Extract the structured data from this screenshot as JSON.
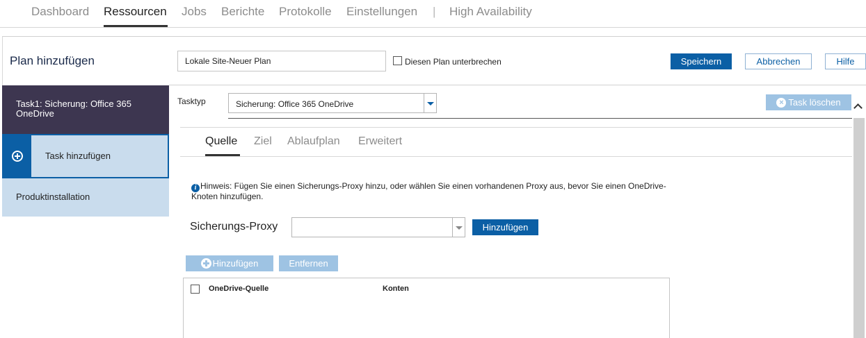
{
  "nav": {
    "items": [
      {
        "label": "Dashboard"
      },
      {
        "label": "Ressourcen"
      },
      {
        "label": "Jobs"
      },
      {
        "label": "Berichte"
      },
      {
        "label": "Protokolle"
      },
      {
        "label": "Einstellungen"
      },
      {
        "label": "High Availability"
      }
    ],
    "separator": "|",
    "active": "Ressourcen"
  },
  "plan": {
    "title": "Plan hinzufügen",
    "name_value": "Lokale Site-Neuer Plan",
    "pause_label": "Diesen Plan unterbrechen",
    "pause_checked": false,
    "save_label": "Speichern",
    "cancel_label": "Abbrechen",
    "help_label": "Hilfe"
  },
  "sidebar": {
    "task1_label": "Task1: Sicherung: Office 365 OneDrive",
    "add_task_label": "Task hinzufügen",
    "product_install_label": "Produktinstallation"
  },
  "task": {
    "type_label": "Tasktyp",
    "type_value": "Sicherung: Office 365 OneDrive",
    "delete_label": "Task löschen"
  },
  "tabs": [
    {
      "label": "Quelle",
      "active": true
    },
    {
      "label": "Ziel",
      "active": false
    },
    {
      "label": "Ablaufplan",
      "active": false
    },
    {
      "label": "Erweitert",
      "active": false
    }
  ],
  "source": {
    "hint": "Hinweis: Fügen Sie einen Sicherungs-Proxy hinzu, oder wählen Sie einen vorhandenen Proxy aus, bevor Sie einen OneDrive-Knoten hinzufügen.",
    "proxy_label": "Sicherungs-Proxy",
    "proxy_value": "",
    "proxy_add_label": "Hinzufügen",
    "add_label": "Hinzufügen",
    "remove_label": "Entfernen",
    "table_headers": [
      "OneDrive-Quelle",
      "Konten"
    ],
    "table_rows": []
  },
  "colors": {
    "accent": "#0b5fa5",
    "sidebar_active": "#3d3650",
    "sidebar_bg": "#c9dced",
    "disabled_button": "#9ec3e3"
  },
  "icons": {
    "add_task": "plus-circle-icon",
    "info": "info-icon",
    "delete": "close-circle-icon",
    "dropdown": "chevron-down-icon",
    "scroll_up": "chevron-up-icon"
  }
}
